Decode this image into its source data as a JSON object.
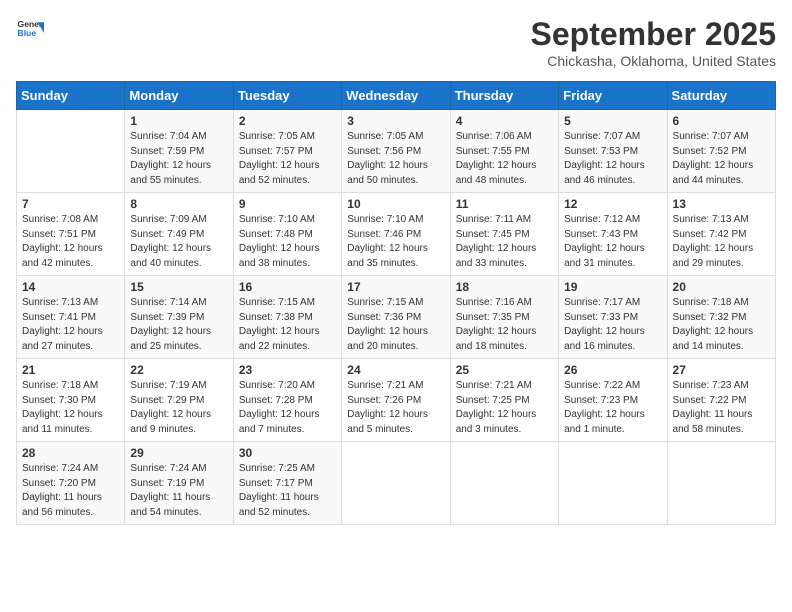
{
  "header": {
    "logo_line1": "General",
    "logo_line2": "Blue",
    "month": "September 2025",
    "location": "Chickasha, Oklahoma, United States"
  },
  "weekdays": [
    "Sunday",
    "Monday",
    "Tuesday",
    "Wednesday",
    "Thursday",
    "Friday",
    "Saturday"
  ],
  "weeks": [
    [
      {
        "day": "",
        "info": ""
      },
      {
        "day": "1",
        "info": "Sunrise: 7:04 AM\nSunset: 7:59 PM\nDaylight: 12 hours\nand 55 minutes."
      },
      {
        "day": "2",
        "info": "Sunrise: 7:05 AM\nSunset: 7:57 PM\nDaylight: 12 hours\nand 52 minutes."
      },
      {
        "day": "3",
        "info": "Sunrise: 7:05 AM\nSunset: 7:56 PM\nDaylight: 12 hours\nand 50 minutes."
      },
      {
        "day": "4",
        "info": "Sunrise: 7:06 AM\nSunset: 7:55 PM\nDaylight: 12 hours\nand 48 minutes."
      },
      {
        "day": "5",
        "info": "Sunrise: 7:07 AM\nSunset: 7:53 PM\nDaylight: 12 hours\nand 46 minutes."
      },
      {
        "day": "6",
        "info": "Sunrise: 7:07 AM\nSunset: 7:52 PM\nDaylight: 12 hours\nand 44 minutes."
      }
    ],
    [
      {
        "day": "7",
        "info": "Sunrise: 7:08 AM\nSunset: 7:51 PM\nDaylight: 12 hours\nand 42 minutes."
      },
      {
        "day": "8",
        "info": "Sunrise: 7:09 AM\nSunset: 7:49 PM\nDaylight: 12 hours\nand 40 minutes."
      },
      {
        "day": "9",
        "info": "Sunrise: 7:10 AM\nSunset: 7:48 PM\nDaylight: 12 hours\nand 38 minutes."
      },
      {
        "day": "10",
        "info": "Sunrise: 7:10 AM\nSunset: 7:46 PM\nDaylight: 12 hours\nand 35 minutes."
      },
      {
        "day": "11",
        "info": "Sunrise: 7:11 AM\nSunset: 7:45 PM\nDaylight: 12 hours\nand 33 minutes."
      },
      {
        "day": "12",
        "info": "Sunrise: 7:12 AM\nSunset: 7:43 PM\nDaylight: 12 hours\nand 31 minutes."
      },
      {
        "day": "13",
        "info": "Sunrise: 7:13 AM\nSunset: 7:42 PM\nDaylight: 12 hours\nand 29 minutes."
      }
    ],
    [
      {
        "day": "14",
        "info": "Sunrise: 7:13 AM\nSunset: 7:41 PM\nDaylight: 12 hours\nand 27 minutes."
      },
      {
        "day": "15",
        "info": "Sunrise: 7:14 AM\nSunset: 7:39 PM\nDaylight: 12 hours\nand 25 minutes."
      },
      {
        "day": "16",
        "info": "Sunrise: 7:15 AM\nSunset: 7:38 PM\nDaylight: 12 hours\nand 22 minutes."
      },
      {
        "day": "17",
        "info": "Sunrise: 7:15 AM\nSunset: 7:36 PM\nDaylight: 12 hours\nand 20 minutes."
      },
      {
        "day": "18",
        "info": "Sunrise: 7:16 AM\nSunset: 7:35 PM\nDaylight: 12 hours\nand 18 minutes."
      },
      {
        "day": "19",
        "info": "Sunrise: 7:17 AM\nSunset: 7:33 PM\nDaylight: 12 hours\nand 16 minutes."
      },
      {
        "day": "20",
        "info": "Sunrise: 7:18 AM\nSunset: 7:32 PM\nDaylight: 12 hours\nand 14 minutes."
      }
    ],
    [
      {
        "day": "21",
        "info": "Sunrise: 7:18 AM\nSunset: 7:30 PM\nDaylight: 12 hours\nand 11 minutes."
      },
      {
        "day": "22",
        "info": "Sunrise: 7:19 AM\nSunset: 7:29 PM\nDaylight: 12 hours\nand 9 minutes."
      },
      {
        "day": "23",
        "info": "Sunrise: 7:20 AM\nSunset: 7:28 PM\nDaylight: 12 hours\nand 7 minutes."
      },
      {
        "day": "24",
        "info": "Sunrise: 7:21 AM\nSunset: 7:26 PM\nDaylight: 12 hours\nand 5 minutes."
      },
      {
        "day": "25",
        "info": "Sunrise: 7:21 AM\nSunset: 7:25 PM\nDaylight: 12 hours\nand 3 minutes."
      },
      {
        "day": "26",
        "info": "Sunrise: 7:22 AM\nSunset: 7:23 PM\nDaylight: 12 hours\nand 1 minute."
      },
      {
        "day": "27",
        "info": "Sunrise: 7:23 AM\nSunset: 7:22 PM\nDaylight: 11 hours\nand 58 minutes."
      }
    ],
    [
      {
        "day": "28",
        "info": "Sunrise: 7:24 AM\nSunset: 7:20 PM\nDaylight: 11 hours\nand 56 minutes."
      },
      {
        "day": "29",
        "info": "Sunrise: 7:24 AM\nSunset: 7:19 PM\nDaylight: 11 hours\nand 54 minutes."
      },
      {
        "day": "30",
        "info": "Sunrise: 7:25 AM\nSunset: 7:17 PM\nDaylight: 11 hours\nand 52 minutes."
      },
      {
        "day": "",
        "info": ""
      },
      {
        "day": "",
        "info": ""
      },
      {
        "day": "",
        "info": ""
      },
      {
        "day": "",
        "info": ""
      }
    ]
  ]
}
